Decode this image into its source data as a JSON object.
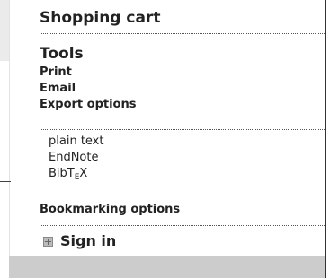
{
  "menu": {
    "shopping_cart": "Shopping cart",
    "tools_title": "Tools",
    "print": "Print",
    "email": "Email",
    "export_options": "Export options",
    "export_items": [
      "plain text",
      "EndNote"
    ],
    "bibtex_prefix": "BibT",
    "bibtex_sub": "E",
    "bibtex_suffix": "X",
    "bookmarking": "Bookmarking options",
    "sign_in": "Sign in",
    "sign_in_icon": "expand-square-icon"
  }
}
